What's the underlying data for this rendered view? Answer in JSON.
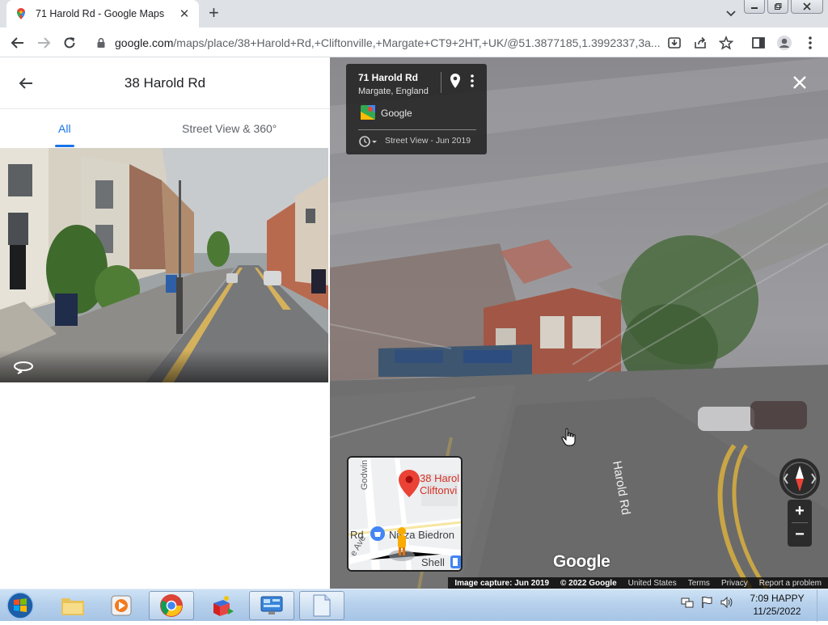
{
  "browser": {
    "tab_title": "71 Harold Rd - Google Maps",
    "tab_close": "✕",
    "new_tab": "+",
    "url_host": "google.com",
    "url_rest": "/maps/place/38+Harold+Rd,+Cliftonville,+Margate+CT9+2HT,+UK/@51.3877185,1.3992337,3a..."
  },
  "left_panel": {
    "title": "38 Harold Rd",
    "tabs": [
      {
        "label": "All"
      },
      {
        "label": "Street View & 360°"
      }
    ]
  },
  "street_view": {
    "card_title": "71 Harold Rd",
    "card_subtitle": "Margate, England",
    "card_source": "Google",
    "card_date": "Street View - Jun 2019",
    "road_label": "Harold Rd",
    "google_logo": "Google",
    "footer": {
      "capture": "Image capture: Jun 2019",
      "copyright": "© 2022 Google",
      "links": [
        "United States",
        "Terms",
        "Privacy",
        "Report a problem"
      ]
    },
    "zoom_in": "+",
    "zoom_out": "−",
    "minimap": {
      "place_line1": "38 Harol",
      "place_line2": "Cliftonvi",
      "street_godwin": "Godwin Rd",
      "road_rd": "Rd",
      "poi": "Nisza Biedron",
      "ave": "e Ave",
      "shell": "Shell"
    }
  },
  "taskbar": {
    "time": "7:09 HAPPY",
    "date": "11/25/2022"
  },
  "colors": {
    "accent": "#1a73e8",
    "pin_red": "#ea4335"
  }
}
